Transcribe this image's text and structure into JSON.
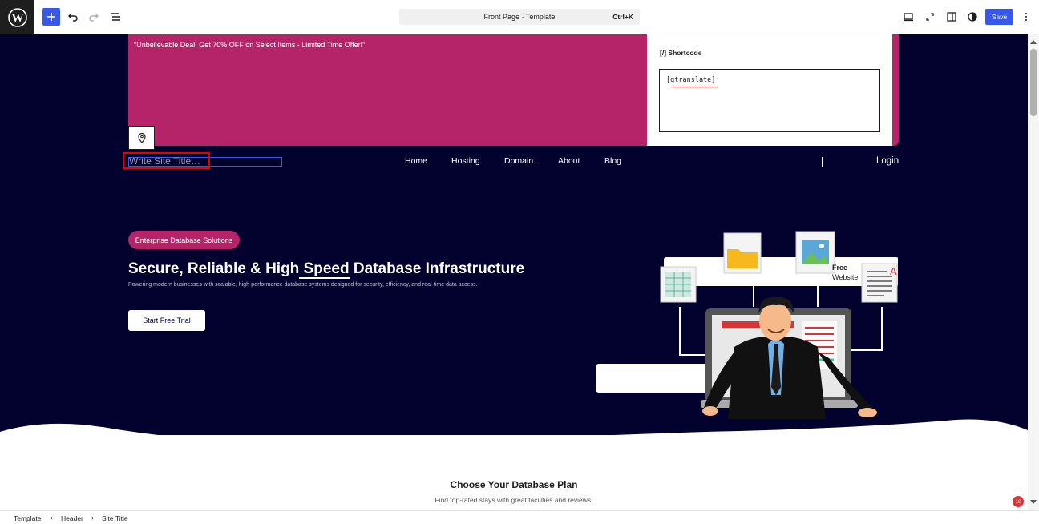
{
  "toolbar": {
    "command_title": "Front Page · Template",
    "command_shortcut": "Ctrl+K",
    "save_label": "Save"
  },
  "promo": {
    "text": "\"Unbelievable Deal: Get 70% OFF on Select Items - Limited Time Offer!\""
  },
  "shortcode": {
    "label": "Shortcode",
    "icon_glyph": "[/]",
    "content": "[gtranslate]"
  },
  "header": {
    "site_title_placeholder": "Write Site Title…",
    "nav": [
      "Home",
      "Hosting",
      "Domain",
      "About",
      "Blog"
    ],
    "login": "Login"
  },
  "hero": {
    "badge": "Enterprise Database Solutions",
    "headline_pre": "Secure, Reliable & High",
    "headline_under": " Speed",
    "headline_post": " Database Infrastructure",
    "subline": "Powering modern businesses with scalable, high-performance database systems designed for security, efficiency, and real-time data access.",
    "cta": "Start Free Trial",
    "free_label": "Free",
    "website_label": "Website"
  },
  "plans": {
    "title": "Choose Your Database Plan",
    "subtitle": "Find top-rated stays with great facilities and reviews."
  },
  "breadcrumb": [
    "Template",
    "Header",
    "Site Title"
  ],
  "notification_count": "10",
  "colors": {
    "navy": "#03022e",
    "magenta": "#b52469",
    "wp_blue": "#3858e9",
    "highlight_red": "#e60000"
  }
}
